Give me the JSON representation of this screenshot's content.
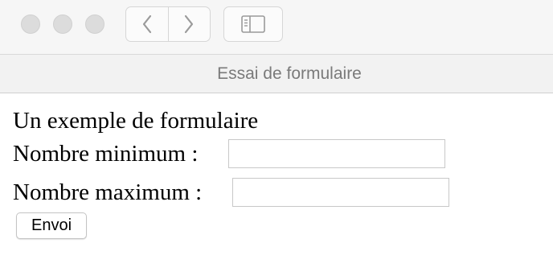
{
  "window": {
    "title": "Essai de formulaire",
    "traffic_lights": [
      "close-button",
      "minimize-button",
      "zoom-button"
    ],
    "icons": {
      "back": "chevron-left-icon",
      "forward": "chevron-right-icon",
      "sidebar": "sidebar-icon"
    },
    "colors": {
      "toolbar_bg": "#f6f6f6",
      "light_gray": "#dcdcdc",
      "title_text": "#7a7a7a"
    }
  },
  "form": {
    "heading": "Un exemple de formulaire",
    "min_label": "Nombre minimum :",
    "min_value": "",
    "max_label": "Nombre maximum :",
    "max_value": "",
    "submit_label": "Envoi"
  }
}
